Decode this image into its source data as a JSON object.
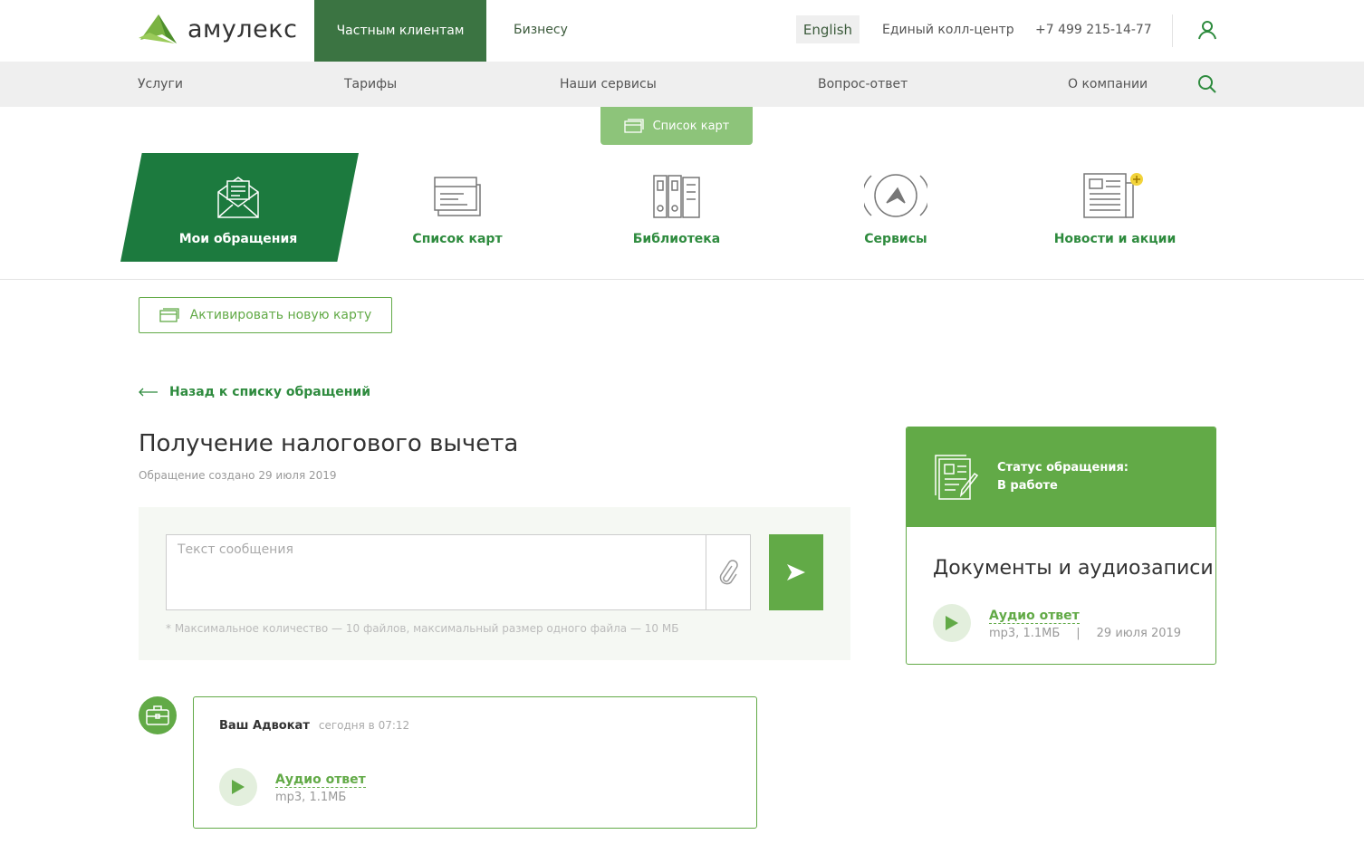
{
  "header": {
    "logo": "амулекс",
    "tabs": [
      "Частным клиентам",
      "Бизнесу"
    ],
    "language": "English",
    "call_center": "Единый колл-центр",
    "phone": "+7 499 215-14-77"
  },
  "nav": [
    "Услуги",
    "Тарифы",
    "Наши сервисы",
    "Вопрос-ответ",
    "О компании"
  ],
  "subtab": "Список карт",
  "categories": [
    "Мои обращения",
    "Список карт",
    "Библиотека",
    "Сервисы",
    "Новости и акции"
  ],
  "activate_button": "Активировать новую карту",
  "back_link": "Назад к списку обращений",
  "request": {
    "title": "Получение налогового вычета",
    "created": "Обращение создано 29 июля 2019"
  },
  "composer": {
    "placeholder": "Текст сообщения",
    "hint": "* Максимальное количество — 10 файлов, максимальный размер одного файла — 10 МБ"
  },
  "status": {
    "label": "Статус обращения:",
    "value": "В работе"
  },
  "documents": {
    "title": "Документы и аудиозаписи",
    "item": {
      "name": "Аудио ответ",
      "meta": "mp3, 1.1МБ",
      "separator": "|",
      "date": "29 июля 2019"
    }
  },
  "message": {
    "author": "Ваш Адвокат",
    "time": "сегодня в 07:12",
    "attachment": {
      "name": "Аудио ответ",
      "meta": "mp3, 1.1МБ"
    }
  },
  "colors": {
    "brand_dark": "#3b7442",
    "active": "#1c7a3e",
    "accent": "#62aa47",
    "text_green": "#2e8b3e"
  }
}
